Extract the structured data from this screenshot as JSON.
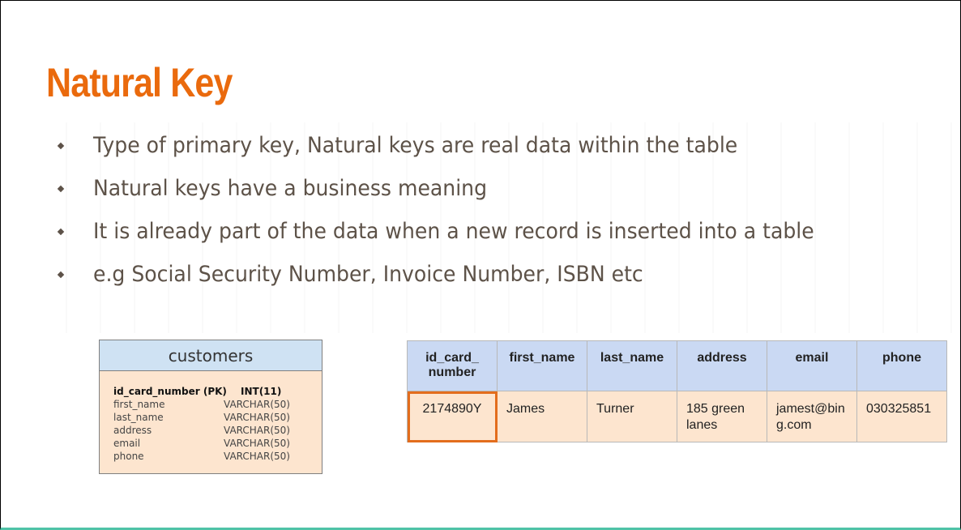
{
  "slide": {
    "title": "Natural Key",
    "bullets": [
      "Type of primary key, Natural keys are real data within the table",
      "Natural keys have a business meaning",
      "It is already part of the data when a new record is inserted into a table",
      "e.g Social Security Number, Invoice Number, ISBN etc"
    ]
  },
  "erd": {
    "table_name": "customers",
    "columns": [
      {
        "name": "id_card_number (PK)",
        "type": "INT(11)"
      },
      {
        "name": "first_name",
        "type": "VARCHAR(50)"
      },
      {
        "name": "last_name",
        "type": "VARCHAR(50)"
      },
      {
        "name": "address",
        "type": "VARCHAR(50)"
      },
      {
        "name": "email",
        "type": "VARCHAR(50)"
      },
      {
        "name": "phone",
        "type": "VARCHAR(50)"
      }
    ]
  },
  "data_table": {
    "headers": [
      "id_card_ number",
      "first_name",
      "last_name",
      "address",
      "email",
      "phone"
    ],
    "row": [
      "2174890Y",
      "James",
      "Turner",
      "185 green lanes",
      "jamest@bin g.com",
      "030325851"
    ]
  },
  "colors": {
    "title": "#ea6a0d",
    "body_text": "#5d5248",
    "header_fill": "#cad9f3",
    "cell_fill": "#fde5cf",
    "highlight": "#e36d1d",
    "bottom_bar": "#4fc3a7"
  }
}
